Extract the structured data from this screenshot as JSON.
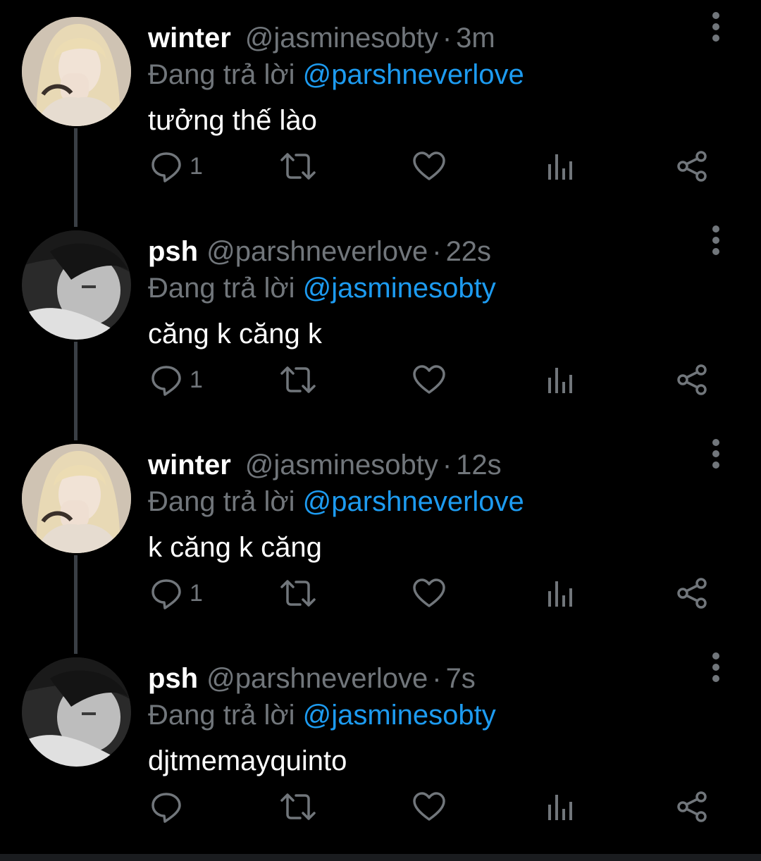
{
  "colors": {
    "background": "#000000",
    "name": "#ffffff",
    "secondary_text": "#71767b",
    "mention": "#1d9bf0",
    "icon": "#71767b"
  },
  "tweets": [
    {
      "name": "winter",
      "handle": "@jasminesobty",
      "separator": "·",
      "time": "3m",
      "replying_prefix": "Đang trả lời",
      "replying_to": "@parshneverlove",
      "text": "tưởng thế lào",
      "reply_count": "1",
      "avatar": "blonde-woman-avatar"
    },
    {
      "name": "psh",
      "handle": "@parshneverlove",
      "separator": "·",
      "time": "22s",
      "replying_prefix": "Đang trả lời",
      "replying_to": "@jasminesobty",
      "text": "căng k căng k",
      "reply_count": "1",
      "avatar": "monochrome-person-avatar"
    },
    {
      "name": "winter",
      "handle": "@jasminesobty",
      "separator": "·",
      "time": "12s",
      "replying_prefix": "Đang trả lời",
      "replying_to": "@parshneverlove",
      "text": "k căng k căng",
      "reply_count": "1",
      "avatar": "blonde-woman-avatar"
    },
    {
      "name": "psh",
      "handle": "@parshneverlove",
      "separator": "·",
      "time": "7s",
      "replying_prefix": "Đang trả lời",
      "replying_to": "@jasminesobty",
      "text": "djtmemayquinto",
      "reply_count": "",
      "avatar": "monochrome-person-avatar"
    }
  ],
  "icons": {
    "reply": "reply-bubble-icon",
    "retweet": "retweet-icon",
    "like": "heart-icon",
    "views": "bar-chart-icon",
    "share": "share-icon",
    "more": "more-vertical-icon"
  }
}
